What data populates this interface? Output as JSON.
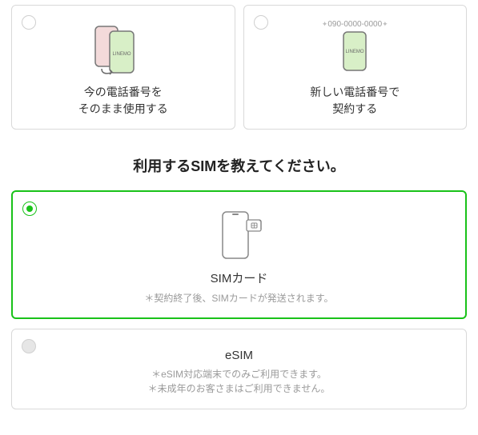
{
  "top": {
    "keepNumber": {
      "line1": "今の電話番号を",
      "line2": "そのまま使用する",
      "brand": "LINEMO"
    },
    "newNumber": {
      "line1": "新しい電話番号で",
      "line2": "契約する",
      "phoneNumber": "090-0000-0000",
      "brand": "LINEMO"
    }
  },
  "heading": "利用するSIMを教えてください。",
  "sim": {
    "physical": {
      "title": "SIMカード",
      "note": "＊契約終了後、SIMカードが発送されます。"
    },
    "esim": {
      "title": "eSIM",
      "note1": "＊eSIM対応端末でのみご利用できます。",
      "note2": "＊未成年のお客さまはご利用できません。"
    }
  }
}
